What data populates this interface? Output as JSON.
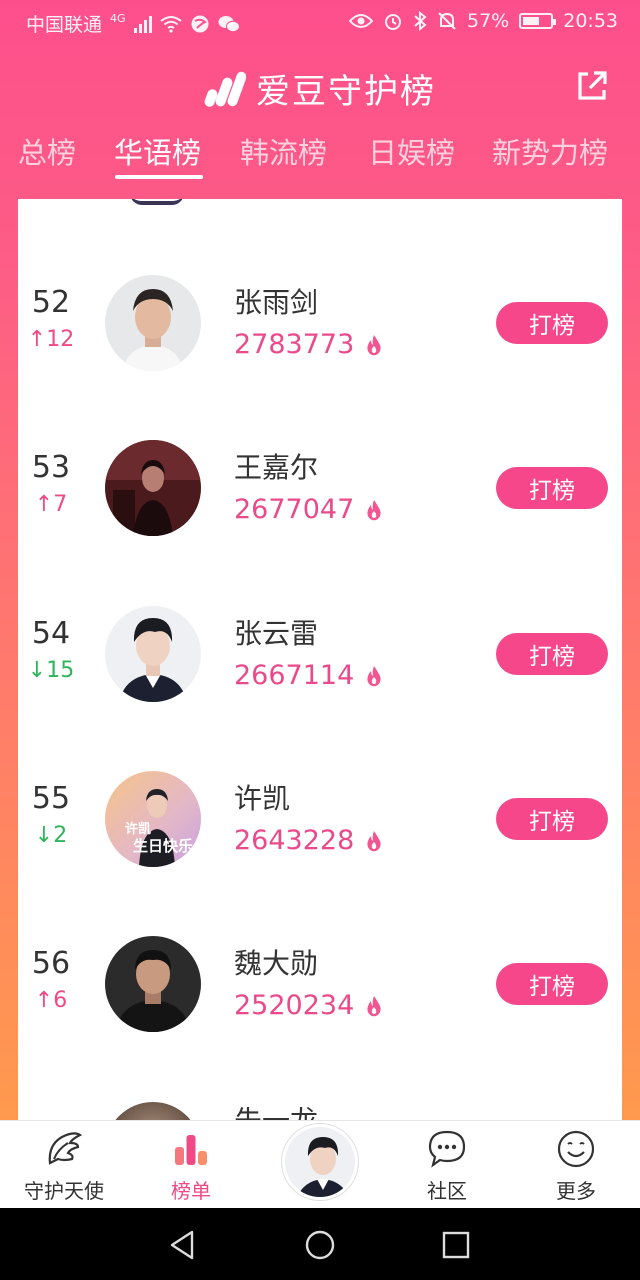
{
  "status_bar": {
    "carrier": "中国联通",
    "network": "4G",
    "battery": "57%",
    "time": "20:53"
  },
  "header": {
    "title": "爱豆守护榜"
  },
  "tabs": [
    {
      "label": "总榜",
      "active": false
    },
    {
      "label": "华语榜",
      "active": true
    },
    {
      "label": "韩流榜",
      "active": false
    },
    {
      "label": "日娱榜",
      "active": false
    },
    {
      "label": "新势力榜",
      "active": false
    }
  ],
  "ranking": [
    {
      "rank": "52",
      "change": "↑12",
      "direction": "up",
      "name": "张雨剑",
      "score": "2783773",
      "button": "打榜"
    },
    {
      "rank": "53",
      "change": "↑7",
      "direction": "up",
      "name": "王嘉尔",
      "score": "2677047",
      "button": "打榜"
    },
    {
      "rank": "54",
      "change": "↓15",
      "direction": "down",
      "name": "张云雷",
      "score": "2667114",
      "button": "打榜"
    },
    {
      "rank": "55",
      "change": "↓2",
      "direction": "down",
      "name": "许凯",
      "score": "2643228",
      "button": "打榜",
      "avatar_text": [
        "许凯",
        "生日快乐"
      ]
    },
    {
      "rank": "56",
      "change": "↑6",
      "direction": "up",
      "name": "魏大勋",
      "score": "2520234",
      "button": "打榜"
    }
  ],
  "partial_row": {
    "name": "朱一龙"
  },
  "bottom_nav": [
    {
      "label": "守护天使",
      "icon": "wing-icon",
      "active": false
    },
    {
      "label": "榜单",
      "icon": "bar-chart-icon",
      "active": true
    },
    {
      "label": "",
      "icon": "avatar",
      "active": false
    },
    {
      "label": "社区",
      "icon": "chat-bubble-icon",
      "active": false
    },
    {
      "label": "更多",
      "icon": "smiley-icon",
      "active": false
    }
  ],
  "colors": {
    "accent": "#f6478a",
    "up": "#f04a86",
    "down": "#2fb55c",
    "gradient_top": "#fd4f8c",
    "gradient_bottom": "#ff9a4d"
  }
}
